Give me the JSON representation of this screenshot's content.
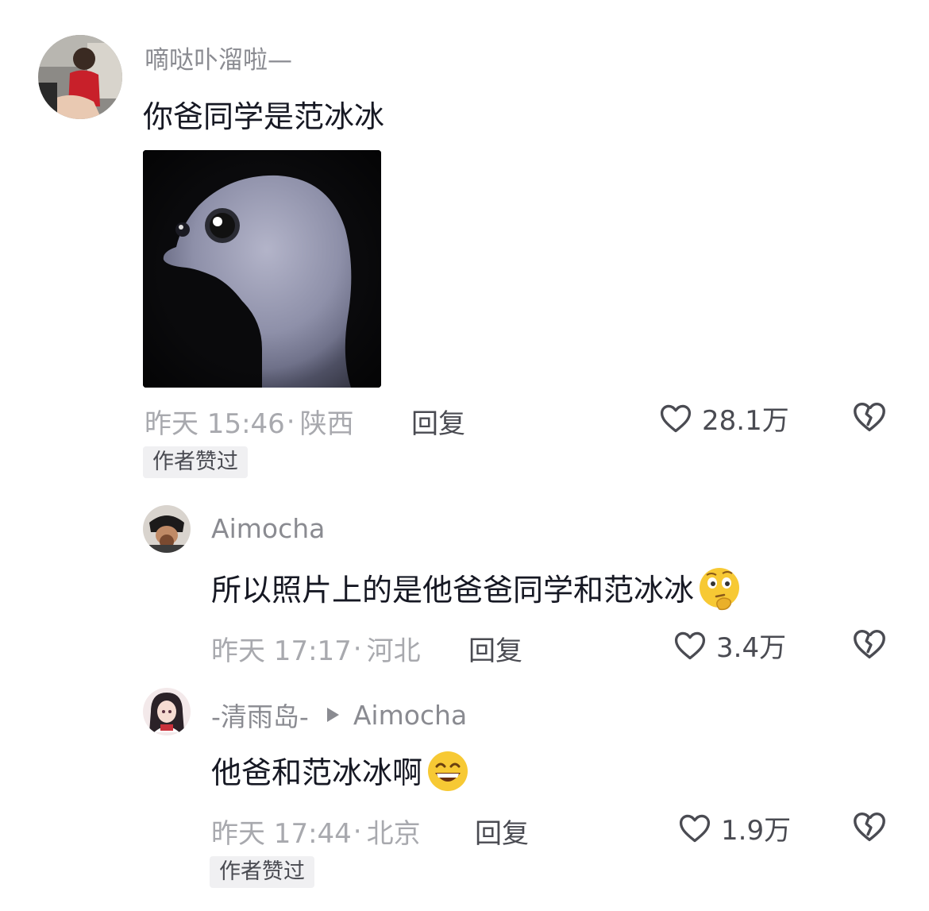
{
  "comments": [
    {
      "username": "嘀哒卟溜啦—",
      "text": "你爸同学是范冰冰",
      "time": "昨天 15:46",
      "location": "陕西",
      "reply_label": "回复",
      "likes": "28.1万",
      "badge": "作者赞过"
    },
    {
      "username": "Aimocha",
      "text": "所以照片上的是他爸爸同学和范冰冰",
      "emoji": "thinking-face-emoji",
      "time": "昨天 17:17",
      "location": "河北",
      "reply_label": "回复",
      "likes": "3.4万"
    },
    {
      "username": "-清雨岛-",
      "reply_to": "Aimocha",
      "text": "他爸和范冰冰啊",
      "emoji": "grinning-face-emoji",
      "time": "昨天 17:44",
      "location": "北京",
      "reply_label": "回复",
      "likes": "1.9万",
      "badge": "作者赞过"
    }
  ],
  "icons": {
    "like": "heart-outline-icon",
    "dislike": "broken-heart-icon",
    "reply_arrow": "triangle-right-icon"
  },
  "colors": {
    "text_primary": "#161823",
    "text_secondary": "#8a8b91",
    "text_meta": "#a8a9ae",
    "badge_bg": "#f0f0f2"
  }
}
